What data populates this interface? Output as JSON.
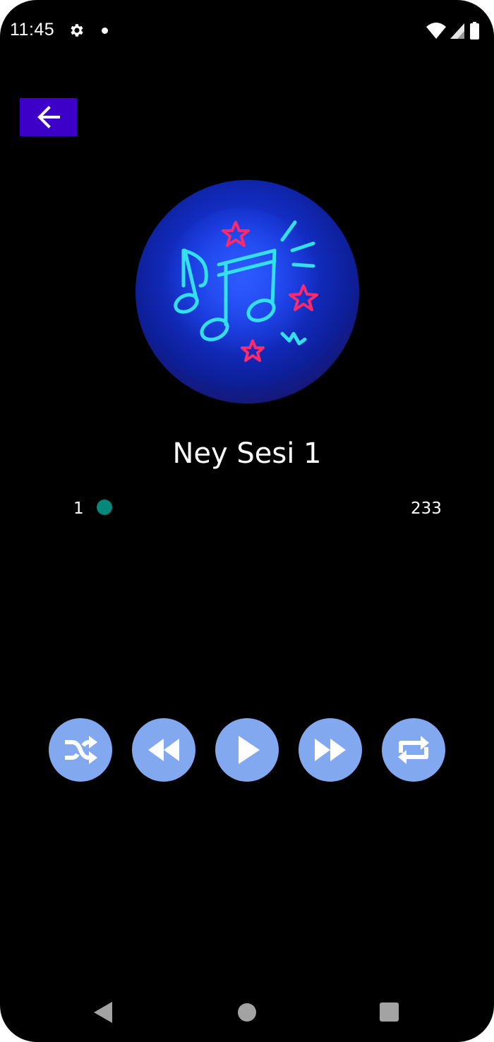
{
  "status_bar": {
    "time": "11:45",
    "icons": [
      "gear-icon",
      "notification-dot-icon",
      "wifi-icon",
      "signal-icon",
      "battery-icon"
    ]
  },
  "header": {
    "back_icon": "arrow-left-icon",
    "back_color": "#3d00c9"
  },
  "player": {
    "artwork_icon": "neon-music-notes-icon",
    "title": "Ney Sesi 1",
    "current_position": "1",
    "duration": "233",
    "progress_fraction": 0.0,
    "accent_color": "#00897b",
    "controls": [
      {
        "icon": "shuffle-icon"
      },
      {
        "icon": "rewind-icon"
      },
      {
        "icon": "play-icon"
      },
      {
        "icon": "fast-forward-icon"
      },
      {
        "icon": "repeat-icon"
      }
    ],
    "control_color": "#82a9ef"
  },
  "nav_bar": {
    "icons": [
      "nav-back-icon",
      "nav-home-icon",
      "nav-recents-icon"
    ]
  }
}
